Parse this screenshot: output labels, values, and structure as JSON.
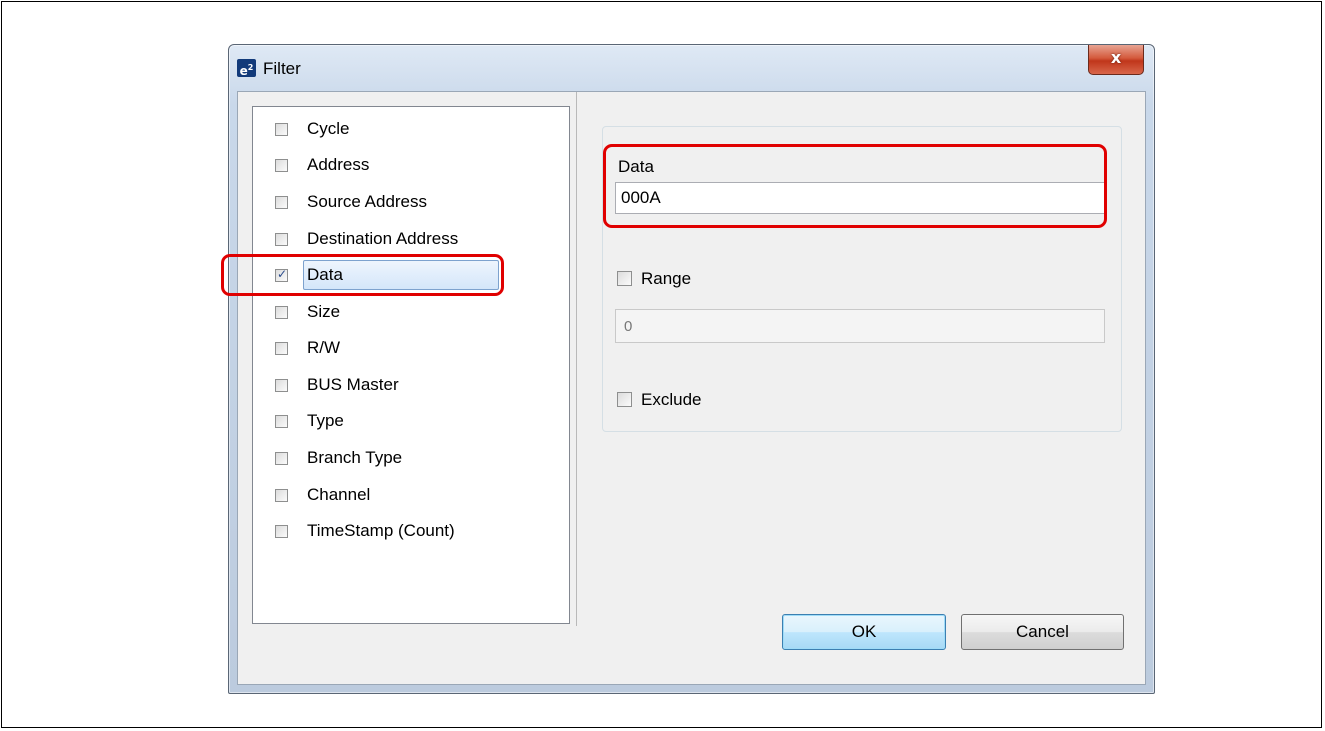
{
  "window": {
    "title": "Filter",
    "app_icon_text": "e",
    "app_icon_sup": "2",
    "close_label": "x"
  },
  "fields": [
    {
      "label": "Cycle",
      "checked": false
    },
    {
      "label": "Address",
      "checked": false
    },
    {
      "label": "Source Address",
      "checked": false
    },
    {
      "label": "Destination Address",
      "checked": false
    },
    {
      "label": "Data",
      "checked": true,
      "selected": true
    },
    {
      "label": "Size",
      "checked": false
    },
    {
      "label": "R/W",
      "checked": false
    },
    {
      "label": "BUS Master",
      "checked": false
    },
    {
      "label": "Type",
      "checked": false
    },
    {
      "label": "Branch Type",
      "checked": false
    },
    {
      "label": "Channel",
      "checked": false
    },
    {
      "label": "TimeStamp (Count)",
      "checked": false
    }
  ],
  "detail": {
    "data_label": "Data",
    "data_value": "000A",
    "range_label": "Range",
    "range_checked": false,
    "range_value": "0",
    "exclude_label": "Exclude",
    "exclude_checked": false
  },
  "buttons": {
    "ok": "OK",
    "cancel": "Cancel"
  },
  "colors": {
    "annotation": "#e00000",
    "selection_border": "#7da2ce",
    "close_button": "#c0361b"
  }
}
